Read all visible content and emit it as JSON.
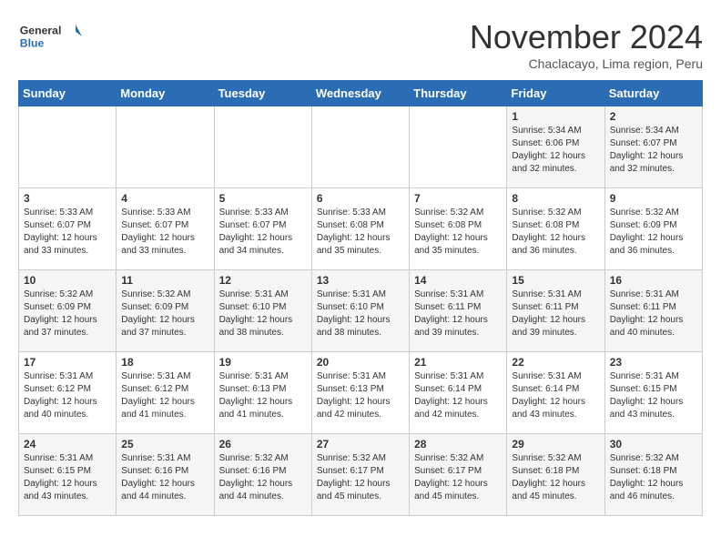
{
  "header": {
    "logo_general": "General",
    "logo_blue": "Blue",
    "month_title": "November 2024",
    "subtitle": "Chaclacayo, Lima region, Peru"
  },
  "days_of_week": [
    "Sunday",
    "Monday",
    "Tuesday",
    "Wednesday",
    "Thursday",
    "Friday",
    "Saturday"
  ],
  "weeks": [
    [
      {
        "day": "",
        "info": ""
      },
      {
        "day": "",
        "info": ""
      },
      {
        "day": "",
        "info": ""
      },
      {
        "day": "",
        "info": ""
      },
      {
        "day": "",
        "info": ""
      },
      {
        "day": "1",
        "info": "Sunrise: 5:34 AM\nSunset: 6:06 PM\nDaylight: 12 hours\nand 32 minutes."
      },
      {
        "day": "2",
        "info": "Sunrise: 5:34 AM\nSunset: 6:07 PM\nDaylight: 12 hours\nand 32 minutes."
      }
    ],
    [
      {
        "day": "3",
        "info": "Sunrise: 5:33 AM\nSunset: 6:07 PM\nDaylight: 12 hours\nand 33 minutes."
      },
      {
        "day": "4",
        "info": "Sunrise: 5:33 AM\nSunset: 6:07 PM\nDaylight: 12 hours\nand 33 minutes."
      },
      {
        "day": "5",
        "info": "Sunrise: 5:33 AM\nSunset: 6:07 PM\nDaylight: 12 hours\nand 34 minutes."
      },
      {
        "day": "6",
        "info": "Sunrise: 5:33 AM\nSunset: 6:08 PM\nDaylight: 12 hours\nand 35 minutes."
      },
      {
        "day": "7",
        "info": "Sunrise: 5:32 AM\nSunset: 6:08 PM\nDaylight: 12 hours\nand 35 minutes."
      },
      {
        "day": "8",
        "info": "Sunrise: 5:32 AM\nSunset: 6:08 PM\nDaylight: 12 hours\nand 36 minutes."
      },
      {
        "day": "9",
        "info": "Sunrise: 5:32 AM\nSunset: 6:09 PM\nDaylight: 12 hours\nand 36 minutes."
      }
    ],
    [
      {
        "day": "10",
        "info": "Sunrise: 5:32 AM\nSunset: 6:09 PM\nDaylight: 12 hours\nand 37 minutes."
      },
      {
        "day": "11",
        "info": "Sunrise: 5:32 AM\nSunset: 6:09 PM\nDaylight: 12 hours\nand 37 minutes."
      },
      {
        "day": "12",
        "info": "Sunrise: 5:31 AM\nSunset: 6:10 PM\nDaylight: 12 hours\nand 38 minutes."
      },
      {
        "day": "13",
        "info": "Sunrise: 5:31 AM\nSunset: 6:10 PM\nDaylight: 12 hours\nand 38 minutes."
      },
      {
        "day": "14",
        "info": "Sunrise: 5:31 AM\nSunset: 6:11 PM\nDaylight: 12 hours\nand 39 minutes."
      },
      {
        "day": "15",
        "info": "Sunrise: 5:31 AM\nSunset: 6:11 PM\nDaylight: 12 hours\nand 39 minutes."
      },
      {
        "day": "16",
        "info": "Sunrise: 5:31 AM\nSunset: 6:11 PM\nDaylight: 12 hours\nand 40 minutes."
      }
    ],
    [
      {
        "day": "17",
        "info": "Sunrise: 5:31 AM\nSunset: 6:12 PM\nDaylight: 12 hours\nand 40 minutes."
      },
      {
        "day": "18",
        "info": "Sunrise: 5:31 AM\nSunset: 6:12 PM\nDaylight: 12 hours\nand 41 minutes."
      },
      {
        "day": "19",
        "info": "Sunrise: 5:31 AM\nSunset: 6:13 PM\nDaylight: 12 hours\nand 41 minutes."
      },
      {
        "day": "20",
        "info": "Sunrise: 5:31 AM\nSunset: 6:13 PM\nDaylight: 12 hours\nand 42 minutes."
      },
      {
        "day": "21",
        "info": "Sunrise: 5:31 AM\nSunset: 6:14 PM\nDaylight: 12 hours\nand 42 minutes."
      },
      {
        "day": "22",
        "info": "Sunrise: 5:31 AM\nSunset: 6:14 PM\nDaylight: 12 hours\nand 43 minutes."
      },
      {
        "day": "23",
        "info": "Sunrise: 5:31 AM\nSunset: 6:15 PM\nDaylight: 12 hours\nand 43 minutes."
      }
    ],
    [
      {
        "day": "24",
        "info": "Sunrise: 5:31 AM\nSunset: 6:15 PM\nDaylight: 12 hours\nand 43 minutes."
      },
      {
        "day": "25",
        "info": "Sunrise: 5:31 AM\nSunset: 6:16 PM\nDaylight: 12 hours\nand 44 minutes."
      },
      {
        "day": "26",
        "info": "Sunrise: 5:32 AM\nSunset: 6:16 PM\nDaylight: 12 hours\nand 44 minutes."
      },
      {
        "day": "27",
        "info": "Sunrise: 5:32 AM\nSunset: 6:17 PM\nDaylight: 12 hours\nand 45 minutes."
      },
      {
        "day": "28",
        "info": "Sunrise: 5:32 AM\nSunset: 6:17 PM\nDaylight: 12 hours\nand 45 minutes."
      },
      {
        "day": "29",
        "info": "Sunrise: 5:32 AM\nSunset: 6:18 PM\nDaylight: 12 hours\nand 45 minutes."
      },
      {
        "day": "30",
        "info": "Sunrise: 5:32 AM\nSunset: 6:18 PM\nDaylight: 12 hours\nand 46 minutes."
      }
    ]
  ]
}
